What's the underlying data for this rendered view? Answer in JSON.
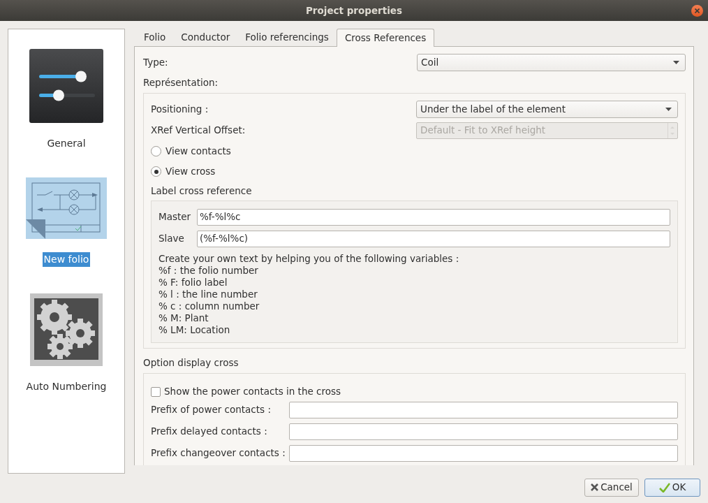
{
  "window": {
    "title": "Project properties"
  },
  "sidebar": {
    "items": [
      {
        "label": "General",
        "kind": "sliders",
        "selected": false
      },
      {
        "label": "New folio",
        "kind": "folio",
        "selected": true
      },
      {
        "label": "Auto Numbering",
        "kind": "gears",
        "selected": false
      }
    ]
  },
  "tabs": [
    {
      "label": "Folio",
      "selected": false
    },
    {
      "label": "Conductor",
      "selected": false
    },
    {
      "label": "Folio referencings",
      "selected": false
    },
    {
      "label": "Cross References",
      "selected": true
    }
  ],
  "type": {
    "label": "Type:",
    "value": "Coil"
  },
  "representation": {
    "title": "Représentation:",
    "positioning": {
      "label": "Positioning :",
      "value": "Under the label of the element"
    },
    "xref_offset": {
      "label": "XRef Vertical Offset:",
      "value": "Default - Fit to XRef height",
      "disabled": true
    },
    "radios": [
      {
        "label": "View contacts",
        "selected": false
      },
      {
        "label": "View cross",
        "selected": true
      }
    ],
    "label_cross_reference": {
      "title": "Label cross reference",
      "master": {
        "label": "Master",
        "value": "%f-%l%c"
      },
      "slave": {
        "label": "Slave",
        "value": "(%f-%l%c)"
      },
      "help_lines": [
        "Create your own text by helping you of the following variables :",
        "%f : the folio number",
        "% F: folio label",
        "% l : the line number",
        "% c : column number",
        "% M: Plant",
        "% LM: Location"
      ]
    }
  },
  "option_display_cross": {
    "title": "Option display cross",
    "show_power": {
      "label": "Show the power contacts in the cross",
      "checked": false
    },
    "prefixes": [
      {
        "label": "Prefix of power contacts :"
      },
      {
        "label": "Prefix delayed contacts :"
      },
      {
        "label": "Prefix changeover contacts :"
      }
    ]
  },
  "buttons": [
    {
      "label": "Cancel",
      "kind": "cancel",
      "default": false
    },
    {
      "label": "OK",
      "kind": "ok",
      "default": true
    }
  ]
}
